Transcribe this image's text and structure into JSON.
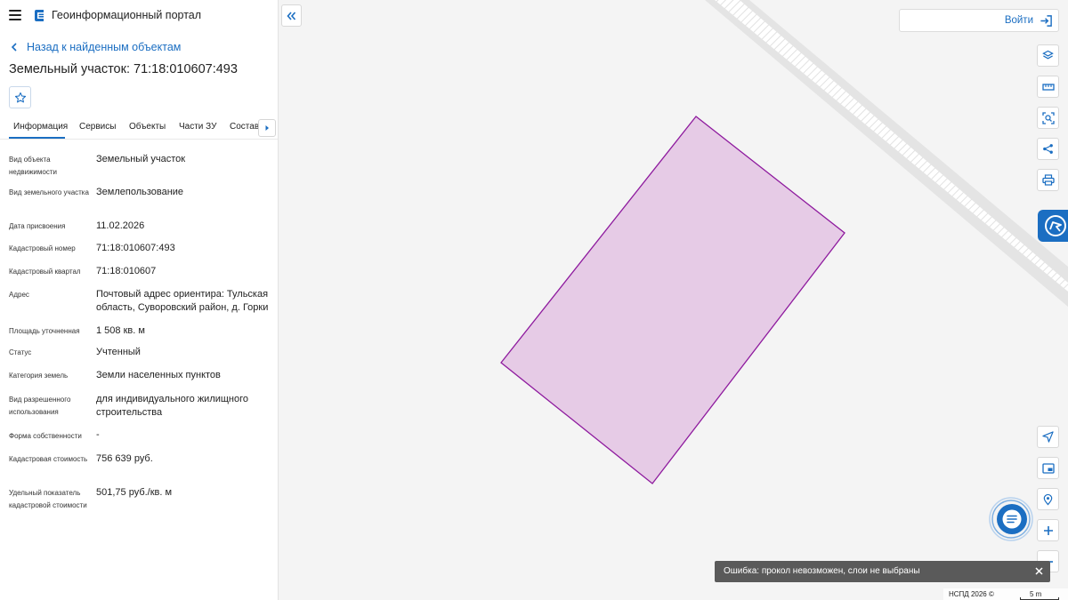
{
  "header": {
    "app_title": "Геоинформационный портал"
  },
  "panel": {
    "back_label": "Назад к найденным объектам",
    "object_title": "Земельный участок: 71:18:010607:493",
    "tabs": [
      {
        "label": "Информация"
      },
      {
        "label": "Сервисы"
      },
      {
        "label": "Объекты"
      },
      {
        "label": "Части ЗУ"
      },
      {
        "label": "Состав"
      }
    ],
    "properties": [
      {
        "label": "Вид объекта недвижимости",
        "value": "Земельный участок"
      },
      {
        "label": "Вид земельного участка",
        "value": "Землепользование"
      },
      {
        "label": "Дата присвоения",
        "value": "11.02.2026"
      },
      {
        "label": "Кадастровый номер",
        "value": "71:18:010607:493"
      },
      {
        "label": "Кадастровый квартал",
        "value": "71:18:010607"
      },
      {
        "label": "Адрес",
        "value": "Почтовый адрес ориентира: Тульская область, Суворовский район, д. Горки"
      },
      {
        "label": "Площадь уточненная",
        "value": "1 508 кв. м"
      },
      {
        "label": "Статус",
        "value": "Учтенный"
      },
      {
        "label": "Категория земель",
        "value": "Земли населенных пунктов"
      },
      {
        "label": "Вид разрешенного использования",
        "value": "для индивидуального жилищного строительства"
      },
      {
        "label": "Форма собственности",
        "value": "-"
      },
      {
        "label": "Кадастровая стоимость",
        "value": "756 639 руб."
      },
      {
        "label": "Удельный показатель кадастровой стоимости",
        "value": "501,75 руб./кв. м"
      }
    ]
  },
  "map": {
    "login_label": "Войти",
    "toast_text": "Ошибка: прокол невозможен, слои не выбраны",
    "copyright": "НСПД 2026 ©",
    "scale_label": "5 m",
    "parcel_fill": "#e6cbe6",
    "parcel_stroke": "#8e1a9e",
    "accent": "#1b6ec2"
  }
}
